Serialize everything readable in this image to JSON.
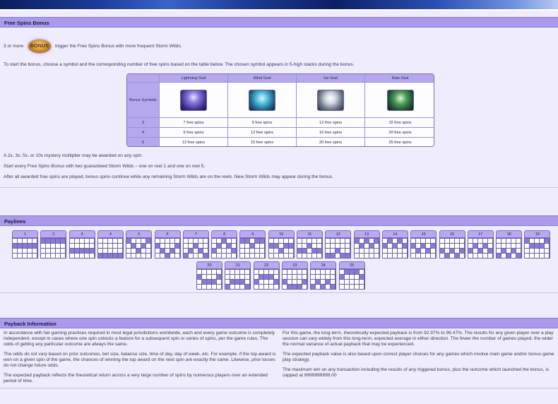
{
  "free_spins": {
    "header": "Free Spins Bonus",
    "scatter_prefix": "3 or more",
    "scatter_logo_text": "BONUS",
    "scatter_suffix": "trigger the Free Spins Bonus with more frequent Storm Wilds.",
    "intro": "To start the bonus, choose a symbol and the corresponding number of free spins based on the table below. The chosen symbol appears in 5-high stacks during the bonus.",
    "table": {
      "columns": [
        "Lightning God",
        "Wind God",
        "Ice God",
        "Rain God"
      ],
      "row_label": "Bonus Symbols",
      "icons": [
        "lightning-god-icon",
        "wind-god-icon",
        "ice-god-icon",
        "rain-god-icon"
      ],
      "rows": [
        {
          "count": "3",
          "values": [
            "7 free spins",
            "9 free spins",
            "12 free spins",
            "15 free spins"
          ]
        },
        {
          "count": "4",
          "values": [
            "9 free spins",
            "12 free spins",
            "16 free spins",
            "20 free spins"
          ]
        },
        {
          "count": "5",
          "values": [
            "12 free spins",
            "15 free spins",
            "20 free spins",
            "25 free spins"
          ]
        }
      ]
    },
    "notes": [
      "A 2x, 3x, 5x, or 10x mystery multiplier may be awarded on any spin.",
      "Start every Free Spins Bonus with two guaranteed Storm Wilds – one on reel 1 and one on reel 5.",
      "After all awarded free spins are played, bonus spins continue while any remaining Storm Wilds are on the reels. New Storm Wilds may appear during the bonus."
    ]
  },
  "paylines": {
    "header": "Paylines",
    "labels": [
      "1",
      "2",
      "3",
      "4",
      "5",
      "6",
      "7",
      "8",
      "9",
      "10",
      "11",
      "12",
      "13",
      "14",
      "15",
      "16",
      "17",
      "18",
      "19",
      "20",
      "21",
      "22",
      "23",
      "24",
      "25"
    ],
    "patterns": [
      [
        1,
        1,
        1,
        1,
        1
      ],
      [
        0,
        0,
        0,
        0,
        0
      ],
      [
        2,
        2,
        2,
        2,
        2
      ],
      [
        3,
        3,
        3,
        3,
        3
      ],
      [
        0,
        1,
        2,
        1,
        0
      ],
      [
        1,
        2,
        3,
        2,
        1
      ],
      [
        3,
        2,
        1,
        2,
        3
      ],
      [
        2,
        1,
        0,
        1,
        2
      ],
      [
        0,
        0,
        1,
        0,
        0
      ],
      [
        1,
        1,
        2,
        1,
        1
      ],
      [
        2,
        2,
        1,
        2,
        2
      ],
      [
        3,
        3,
        2,
        3,
        3
      ],
      [
        0,
        1,
        0,
        1,
        0
      ],
      [
        1,
        0,
        1,
        0,
        1
      ],
      [
        1,
        2,
        1,
        2,
        1
      ],
      [
        2,
        3,
        2,
        3,
        2
      ],
      [
        2,
        1,
        2,
        1,
        2
      ],
      [
        3,
        2,
        3,
        2,
        3
      ],
      [
        0,
        1,
        1,
        1,
        0
      ],
      [
        1,
        2,
        2,
        2,
        1
      ],
      [
        3,
        2,
        2,
        2,
        3
      ],
      [
        2,
        1,
        1,
        1,
        2
      ],
      [
        2,
        3,
        3,
        3,
        2
      ],
      [
        3,
        2,
        3,
        2,
        3
      ],
      [
        1,
        0,
        0,
        0,
        1
      ]
    ]
  },
  "payback": {
    "header": "Payback Information",
    "left": [
      "In accordance with fair gaming practices required in most legal jurisdictions worldwide, each and every game outcome is completely independent, except in cases where one spin unlocks a feature for a subsequent spin or series of spins, per the game rules. The odds of getting any particular outcome are always the same.",
      "The odds do not vary based on prior outcomes, bet size, balance size, time of day, day of week, etc. For example, if the top award is won on a given spin of the game, the chances of winning the top award on the next spin are exactly the same. Likewise, prior losses do not change future odds.",
      "The expected payback reflects the theoretical return across a very large number of spins by numerous players over an extended period of time."
    ],
    "right": [
      "For this game, the long-term, theoretically expected payback is from 92.97% to 96.47%. The results for any given player over a play session can vary widely from this long-term, expected average in either direction. The fewer the number of games played, the wider the normal variance of actual payback that may be experienced.",
      "The expected payback value is also based upon correct player choices for any games which involve main game and/or bonus game play strategy.",
      "The maximum win on any transaction including the results of any triggered bonus, plus the outcome which launched the bonus, is capped at 9999999999.00"
    ]
  },
  "colors": {
    "header_bg": "#a99aea",
    "page_bg": "#efedfd",
    "payline_fill": "#8a7ad6"
  }
}
